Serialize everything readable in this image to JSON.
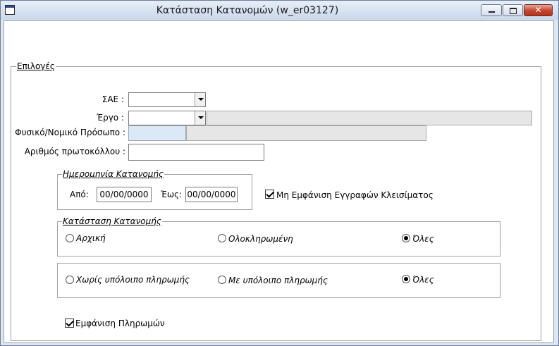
{
  "window": {
    "title": "Κατάσταση Κατανομών   (w_er03127)",
    "close_glyph": "✕"
  },
  "options": {
    "legend": "Επιλογές",
    "sae_label": "ΣΑΕ :",
    "sae_value": "",
    "ergo_label": "Έργο :",
    "ergo_value": "",
    "ergo_description": "",
    "person_label": "Φυσικό/Νομικό Πρόσωπο :",
    "person_code": "",
    "person_name": "",
    "protocol_label": "Αριθμός πρωτοκόλλου  :",
    "protocol_value": ""
  },
  "date_group": {
    "legend": "Ημερομηνία Κατανομής",
    "from_label": "Από:",
    "from_value": "00/00/0000",
    "to_label": "Έως:",
    "to_value": "00/00/0000"
  },
  "hide_closing": {
    "label": "Μη Εμφάνιση Εγγραφών Κλεισίματος",
    "checked": true
  },
  "status_group": {
    "legend": "Κατάσταση Κατανομής",
    "options": [
      "Αρχική",
      "Ολοκληρωμένη",
      "Όλες"
    ],
    "selected": "Όλες"
  },
  "balance_group": {
    "options": [
      "Χωρίς υπόλοιπο πληρωμής",
      "Με υπόλοιπο πληρωμής",
      "Όλες"
    ],
    "selected": "Όλες"
  },
  "show_payments": {
    "label": "Εμφάνιση Πληρωμών",
    "checked": true
  }
}
